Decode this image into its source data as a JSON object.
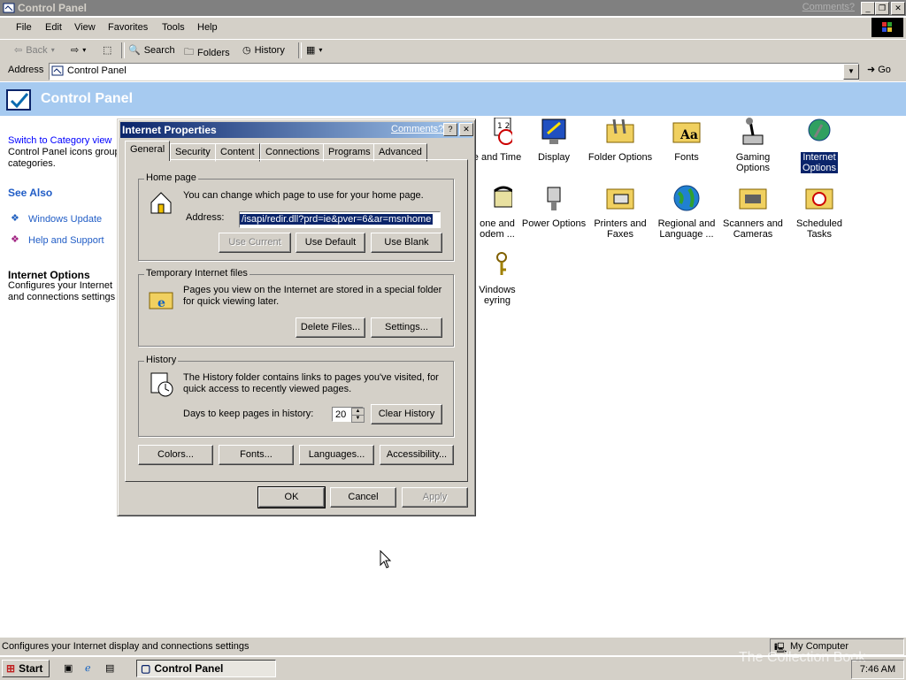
{
  "window": {
    "title": "Control Panel",
    "comments_link": "Comments?"
  },
  "menu": [
    "File",
    "Edit",
    "View",
    "Favorites",
    "Tools",
    "Help"
  ],
  "toolbar": {
    "back": "Back",
    "search": "Search",
    "folders": "Folders",
    "history": "History"
  },
  "address": {
    "label": "Address",
    "value": "Control Panel",
    "go": "Go"
  },
  "banner": {
    "title": "Control Panel"
  },
  "sidebar": {
    "switch_link": "Switch to Category view",
    "switch_text_1": "Control Panel icons group",
    "switch_text_2": "categories.",
    "see_also": "See Also",
    "windows_update": "Windows Update",
    "help_support": "Help and Support",
    "info_title": "Internet Options",
    "info_text_1": "Configures your Internet",
    "info_text_2": "and connections settings"
  },
  "icons": [
    {
      "label_1": "e and Time",
      "label_2": ""
    },
    {
      "label_1": "Display",
      "label_2": ""
    },
    {
      "label_1": "Folder Options",
      "label_2": ""
    },
    {
      "label_1": "Fonts",
      "label_2": ""
    },
    {
      "label_1": "Gaming",
      "label_2": "Options"
    },
    {
      "label_1": "Internet",
      "label_2": "Options"
    },
    {
      "label_1": "one and",
      "label_2": "odem ..."
    },
    {
      "label_1": "Power Options",
      "label_2": ""
    },
    {
      "label_1": "Printers and",
      "label_2": "Faxes"
    },
    {
      "label_1": "Regional and",
      "label_2": "Language ..."
    },
    {
      "label_1": "Scanners and",
      "label_2": "Cameras"
    },
    {
      "label_1": "Scheduled",
      "label_2": "Tasks"
    },
    {
      "label_1": "Vindows",
      "label_2": "eyring"
    }
  ],
  "dialog": {
    "title": "Internet Properties",
    "comments_link": "Comments?",
    "tabs": [
      "General",
      "Security",
      "Content",
      "Connections",
      "Programs",
      "Advanced"
    ],
    "home": {
      "group": "Home page",
      "desc": "You can change which page to use for your home page.",
      "address_label": "Address:",
      "address_value": "/isapi/redir.dll?prd=ie&pver=6&ar=msnhome",
      "use_current": "Use Current",
      "use_default": "Use Default",
      "use_blank": "Use Blank"
    },
    "temp": {
      "group": "Temporary Internet files",
      "desc_1": "Pages you view on the Internet are stored in a special folder",
      "desc_2": "for quick viewing later.",
      "delete": "Delete Files...",
      "settings": "Settings..."
    },
    "history": {
      "group": "History",
      "desc_1": "The History folder contains links to pages you've visited, for",
      "desc_2": "quick access to recently viewed pages.",
      "days_label": "Days to keep pages in history:",
      "days_value": "20",
      "clear": "Clear History"
    },
    "bottom_buttons": {
      "colors": "Colors...",
      "fonts": "Fonts...",
      "languages": "Languages...",
      "accessibility": "Accessibility..."
    },
    "ok": "OK",
    "cancel": "Cancel",
    "apply": "Apply"
  },
  "status": {
    "text": "Configures your Internet display and connections settings",
    "zone": "My Computer"
  },
  "taskbar": {
    "start": "Start",
    "task": "Control Panel",
    "clock": "7:46 AM",
    "watermark": "The Collection Book"
  }
}
